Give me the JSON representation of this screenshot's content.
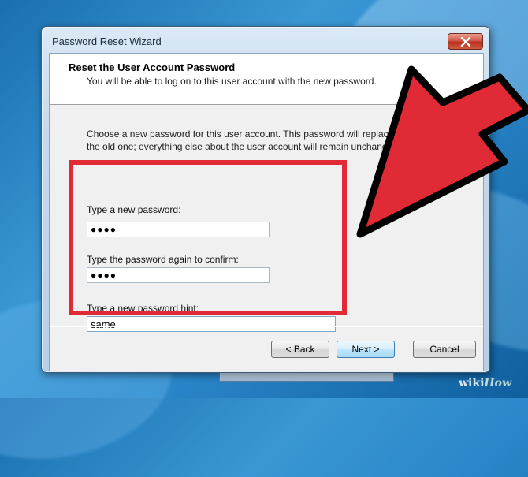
{
  "window": {
    "title": "Password Reset Wizard",
    "close_icon": "close-icon"
  },
  "header": {
    "title": "Reset the User Account Password",
    "subtitle": "You will be able to log on to this user account with the new password."
  },
  "body": {
    "description_line1": "Choose a new password for this user account. This password will replace",
    "description_line2": "the old one; everything else about the user account will remain unchanged."
  },
  "form": {
    "new_password_label": "Type a new password:",
    "new_password_value": "●●●●",
    "confirm_label": "Type the password again to confirm:",
    "confirm_value": "●●●●",
    "hint_label": "Type a new password hint:",
    "hint_value": "same"
  },
  "buttons": {
    "back": "< Back",
    "next": "Next >",
    "cancel": "Cancel"
  },
  "watermark": {
    "wiki": "wiki",
    "how": "How"
  },
  "colors": {
    "highlight": "#e02b36",
    "arrow_fill": "#e02b36",
    "arrow_stroke": "#000000"
  }
}
